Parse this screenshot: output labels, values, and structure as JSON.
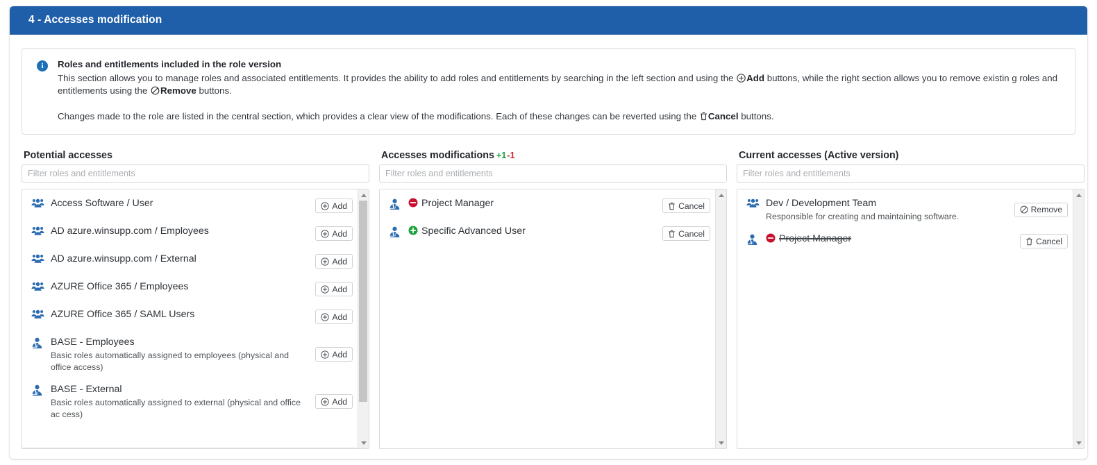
{
  "header": {
    "title": "4 - Accesses modification"
  },
  "info": {
    "icon": "info-circle-icon",
    "title": "Roles and entitlements included in the role version",
    "para1_a": "This section allows you to manage roles and associated entitlements. It provides the ability to add roles and entitlements by searching in the left section and using the ",
    "para1_add": "Add",
    "para1_b": " buttons, while the right section allows you to remove existin g roles and entitlements using the ",
    "para1_remove": "Remove",
    "para1_c": " buttons.",
    "para2_a": "Changes made to the role are listed in the central section, which provides a clear view of the modifications. Each of these changes can be reverted using the ",
    "para2_cancel": "Cancel",
    "para2_b": " buttons."
  },
  "colors": {
    "header_blue": "#1f5fa9",
    "icon_blue": "#2b6cb0",
    "add_green": "#18a23a",
    "remove_red": "#c8102e",
    "info_blue": "#1d6fb8"
  },
  "columns": {
    "potential": {
      "title": "Potential accesses",
      "filter_placeholder": "Filter roles and entitlements",
      "filter_value": "",
      "items": [
        {
          "icon": "users-group-icon",
          "label": "Access Software / User",
          "desc": "",
          "action": "Add",
          "action_icon": "plus-circle-icon"
        },
        {
          "icon": "users-group-icon",
          "label": "AD azure.winsupp.com / Employees",
          "desc": "",
          "action": "Add",
          "action_icon": "plus-circle-icon"
        },
        {
          "icon": "users-group-icon",
          "label": "AD azure.winsupp.com / External",
          "desc": "",
          "action": "Add",
          "action_icon": "plus-circle-icon"
        },
        {
          "icon": "users-group-icon",
          "label": "AZURE Office 365 / Employees",
          "desc": "",
          "action": "Add",
          "action_icon": "plus-circle-icon"
        },
        {
          "icon": "users-group-icon",
          "label": "AZURE Office 365 / SAML Users",
          "desc": "",
          "action": "Add",
          "action_icon": "plus-circle-icon"
        },
        {
          "icon": "user-tie-icon",
          "label": "BASE - Employees",
          "desc": "Basic roles automatically assigned to employees (physical and office access)",
          "action": "Add",
          "action_icon": "plus-circle-icon"
        },
        {
          "icon": "user-tie-icon",
          "label": "BASE - External",
          "desc": "Basic roles automatically assigned to external (physical and office ac cess)",
          "action": "Add",
          "action_icon": "plus-circle-icon"
        }
      ]
    },
    "modifications": {
      "title": "Accesses modifications",
      "count_added": "+1",
      "count_removed": "-1",
      "filter_placeholder": "Filter roles and entitlements",
      "filter_value": "",
      "items": [
        {
          "icon": "user-tie-icon",
          "status": "removed",
          "status_icon": "minus-circle-icon",
          "label": "Project Manager",
          "desc": "",
          "action": "Cancel",
          "action_icon": "trash-icon"
        },
        {
          "icon": "user-tie-icon",
          "status": "added",
          "status_icon": "plus-circle-icon",
          "label": "Specific Advanced User",
          "desc": "",
          "action": "Cancel",
          "action_icon": "trash-icon"
        }
      ]
    },
    "current": {
      "title": "Current accesses (Active version)",
      "filter_placeholder": "Filter roles and entitlements",
      "filter_value": "",
      "items": [
        {
          "icon": "users-group-icon",
          "status": "none",
          "label": "Dev / Development Team",
          "desc": "Responsible for creating and maintaining software.",
          "action": "Remove",
          "action_icon": "ban-icon",
          "struck": false
        },
        {
          "icon": "user-tie-icon",
          "status": "removed",
          "status_icon": "minus-circle-icon",
          "label": "Project Manager",
          "desc": "",
          "action": "Cancel",
          "action_icon": "trash-icon",
          "struck": true
        }
      ]
    }
  }
}
